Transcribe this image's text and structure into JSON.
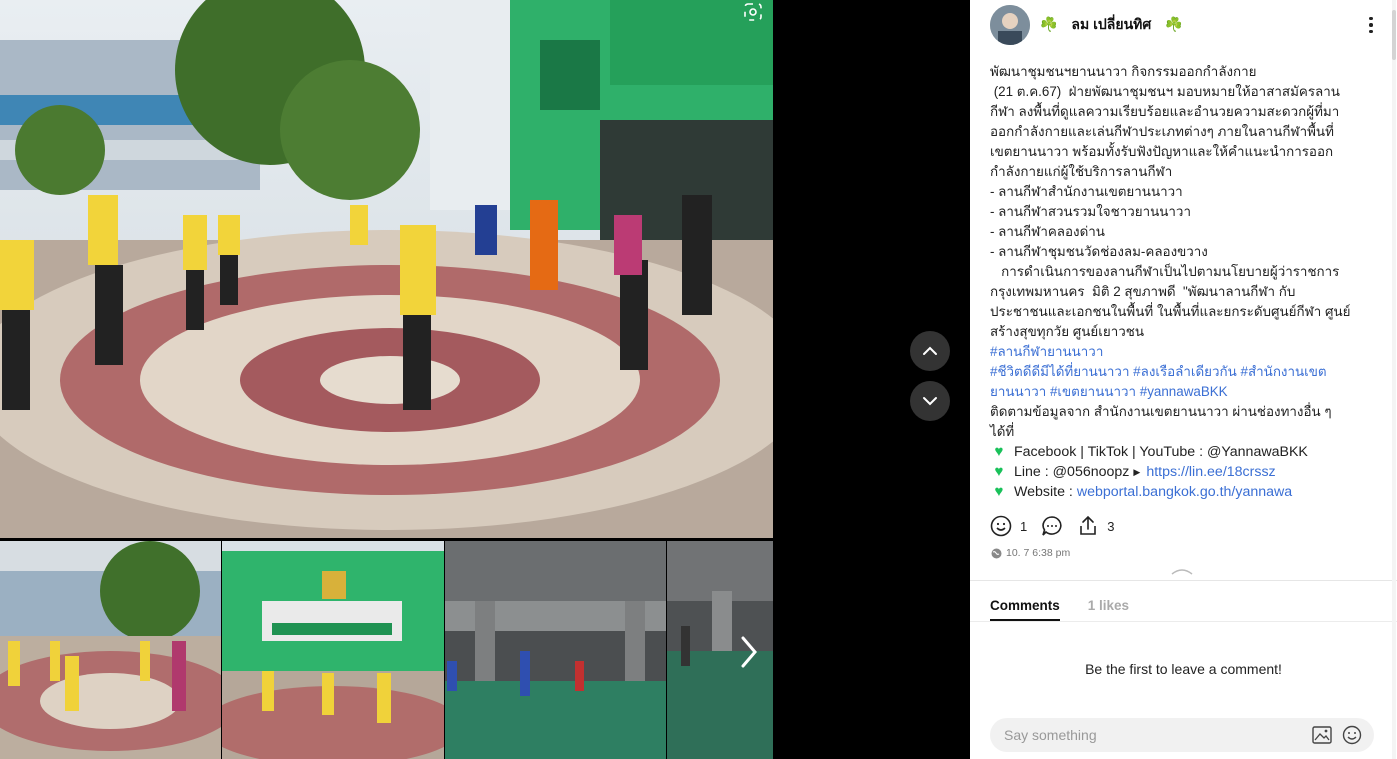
{
  "author": {
    "name": "☘️ ลม เปลี่ยนทิศ ☘️"
  },
  "post": {
    "lines": [
      "พัฒนาชุมชนฯยานนาวา กิจกรรมออกกำลังกาย",
      " (21 ต.ค.67)  ฝ่ายพัฒนาชุมชนฯ มอบหมายให้อาสาสมัครลาน",
      "กีฬา ลงพื้นที่ดูแลความเรียบร้อยและอำนวยความสะดวกผู้ที่มา",
      "ออกกำลังกายและเล่นกีฬาประเภทต่างๆ ภายในลานกีฬาพื้นที่",
      "เขตยานนาวา พร้อมทั้งรับฟังปัญหาและให้คำแนะนำการออก",
      "กำลังกายแก่ผู้ใช้บริการลานกีฬา",
      "- ลานกีฬาสำนักงานเขตยานนาวา",
      "- ลานกีฬาสวนรวมใจชาวยานนาวา",
      "- ลานกีฬาคลองด่าน",
      "- ลานกีฬาชุมชนวัดช่องลม-คลองขวาง",
      "   การดำเนินการของลานกีฬาเป็นไปตามนโยบายผู้ว่าราชการ",
      "กรุงเทพมหานคร  มิติ 2 สุขภาพดี  \"พัฒนาลานกีฬา กับ",
      "ประชาชนและเอกชนในพื้นที่ ในพื้นที่และยกระดับศูนย์กีฬา ศูนย์",
      "สร้างสุขทุกวัย ศูนย์เยาวชน"
    ],
    "hashtag1": "#ลานกีฬายานนาวา",
    "hashtag2a": "#ชีวิตดีดีมีได้ที่ยานนาวา #ลงเรือลำเดียวกัน #สำนักงานเขต",
    "hashtag2b": "ยานนาวา #เขตยานนาวา #yannawaBKK",
    "follow1": "ติดตามข้อมูลจาก สำนักงานเขตยานนาวา ผ่านช่องทางอื่น ๆ",
    "follow2": "ได้ที่",
    "contact1": "Facebook | TikTok | YouTube : @YannawaBKK",
    "contact2_prefix": "Line : @056noopz",
    "contact2_link": "https://lin.ee/18crssz",
    "contact3_prefix": "Website : ",
    "contact3_link": "webportal.bangkok.go.th/yannawa"
  },
  "actions": {
    "reactions": "1",
    "shares": "3"
  },
  "timestamp": "10. 7 6:38 pm",
  "tabs": {
    "comments": "Comments",
    "likes": "1 likes"
  },
  "empty_state": "Be the first to leave a comment!",
  "comment_placeholder": "Say something",
  "icons": [
    "lens-icon",
    "chevron-up-icon",
    "chevron-down-icon",
    "chevron-right-icon",
    "more-vertical-icon",
    "smile-icon",
    "comment-icon",
    "share-icon",
    "globe-icon",
    "image-icon",
    "emoji-icon",
    "heart-icon"
  ]
}
